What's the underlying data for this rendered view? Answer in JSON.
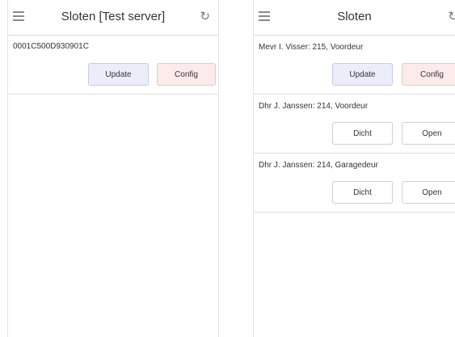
{
  "left_screen": {
    "title": "Sloten [Test server]",
    "device_id": "0001C500D930901C",
    "update_label": "Update",
    "config_label": "Config"
  },
  "right_screen": {
    "title": "Sloten",
    "config_row": {
      "label": "Mevr I. Visser: 215, Voordeur",
      "update_label": "Update",
      "config_label": "Config"
    },
    "locks": [
      {
        "label": "Dhr J. Janssen: 214, Voordeur",
        "close_label": "Dicht",
        "open_label": "Open"
      },
      {
        "label": "Dhr J. Janssen: 214, Garagedeur",
        "close_label": "Dicht",
        "open_label": "Open"
      }
    ]
  },
  "icons": {
    "menu": "hamburger-icon",
    "refresh": "refresh-icon"
  },
  "colors": {
    "update_bg": "#ebeefa",
    "config_bg": "#fdeaea"
  }
}
